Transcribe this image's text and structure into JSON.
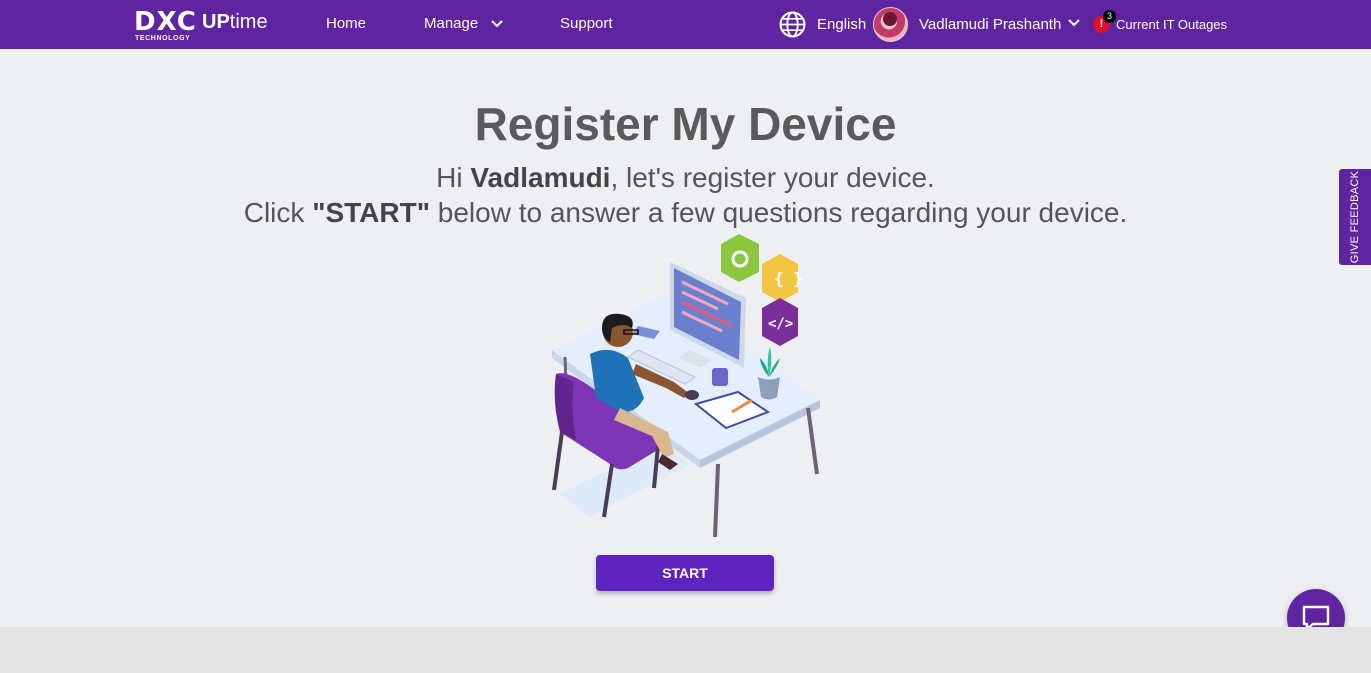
{
  "header": {
    "logo_main": "DXC",
    "logo_sub": "TECHNOLOGY",
    "logo_product_prefix": "UP",
    "logo_product": "time",
    "nav": {
      "home": "Home",
      "manage": "Manage",
      "support": "Support"
    },
    "language": "English",
    "user_name": "Vadlamudi Prashanth",
    "alert_symbol": "!",
    "outage_count": "3",
    "outages_label": "Current IT Outages",
    "icons": [
      "globe-icon",
      "chevron-down-icon",
      "alert-icon"
    ]
  },
  "main": {
    "title": "Register My Device",
    "greeting_prefix": "Hi ",
    "user_first_name": "Vadlamudi",
    "greeting_suffix": ", let's register your device.",
    "instruction_prefix": "Click ",
    "instruction_keyword": "\"START\"",
    "instruction_suffix": " below to answer a few questions regarding your device.",
    "start_button": "START"
  },
  "feedback_tab": "GIVE FEEDBACK",
  "colors": {
    "brand_purple": "#5f249f",
    "button_purple": "#5f24c0",
    "page_bg": "#eeeff3",
    "alert_red": "#e10e2b"
  }
}
